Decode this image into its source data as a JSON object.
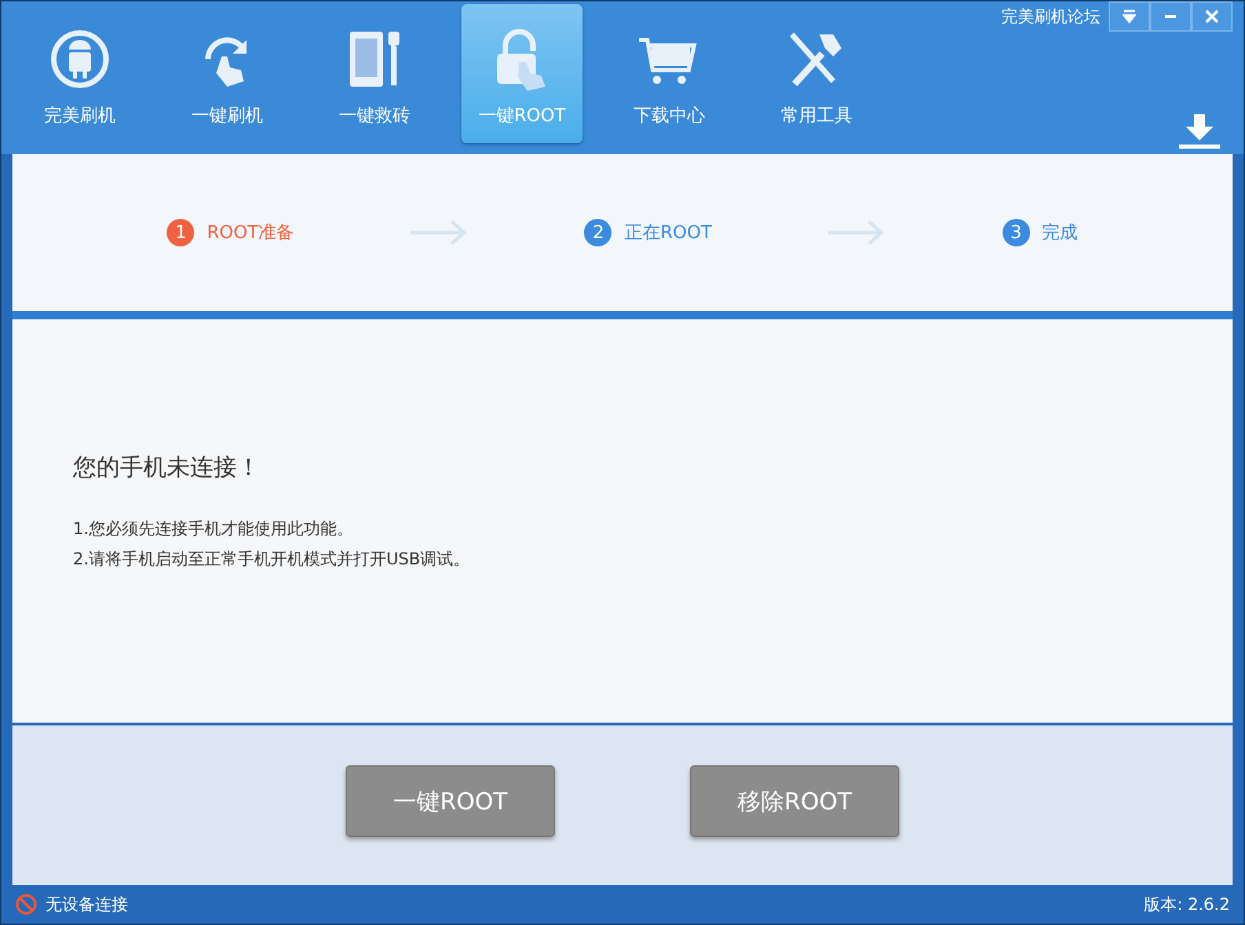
{
  "window": {
    "forum_link": "完美刷机论坛"
  },
  "tabs": [
    {
      "label": "完美刷机",
      "selected": false
    },
    {
      "label": "一键刷机",
      "selected": false
    },
    {
      "label": "一键救砖",
      "selected": false
    },
    {
      "label": "一键ROOT",
      "selected": true
    },
    {
      "label": "下载中心",
      "selected": false
    },
    {
      "label": "常用工具",
      "selected": false
    }
  ],
  "steps": [
    {
      "number": "1",
      "label": "ROOT准备",
      "selected": true
    },
    {
      "number": "2",
      "label": "正在ROOT",
      "selected": false
    },
    {
      "number": "3",
      "label": "完成",
      "selected": false
    }
  ],
  "message": {
    "title": "您的手机未连接！",
    "lines": [
      "1.您必须先连接手机才能使用此功能。",
      "2.请将手机启动至正常手机开机模式并打开USB调试。"
    ]
  },
  "buttons": [
    "一键ROOT",
    "移除ROOT"
  ],
  "status_bar": {
    "connection": "无设备连接",
    "version": "版本: 2.6.2"
  }
}
